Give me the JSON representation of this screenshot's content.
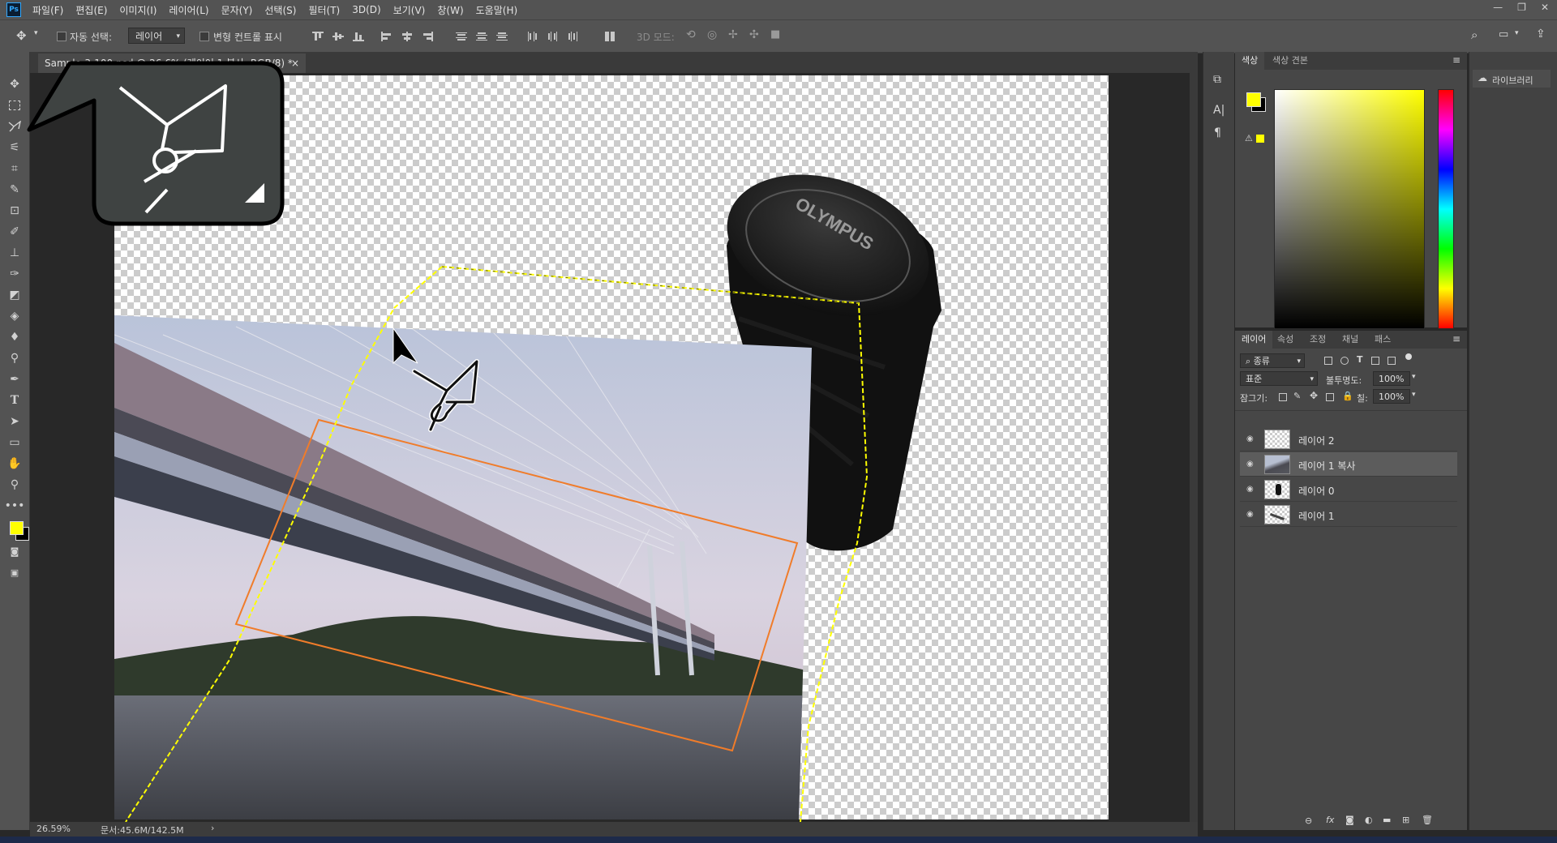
{
  "app": {
    "logo": "Ps"
  },
  "menu": [
    "파일(F)",
    "편집(E)",
    "이미지(I)",
    "레이어(L)",
    "문자(Y)",
    "선택(S)",
    "필터(T)",
    "3D(D)",
    "보기(V)",
    "창(W)",
    "도움말(H)"
  ],
  "window_controls": {
    "minimize": "—",
    "restore": "❐",
    "close": "✕"
  },
  "options": {
    "auto_select_label": "자동 선택:",
    "auto_select_value": "레이어",
    "transform_controls_label": "변형 컨트롤 표시",
    "mode_3d_label": "3D 모드:"
  },
  "document": {
    "tab_title": "Sample-3-100.psd @ 26.6% (레이어 1 복사, RGB/8) *",
    "tab_close": "×"
  },
  "canvas": {
    "lens_cap_text": "OLYMPUS"
  },
  "status": {
    "zoom": "26.59%",
    "doc_size": "문서:45.6M/142.5M",
    "arrow": "›"
  },
  "color_panel": {
    "tabs": [
      "색상",
      "색상 견본"
    ],
    "foreground": "#ffff00",
    "background": "#000000"
  },
  "layers_panel": {
    "tabs": [
      "레이어",
      "속성",
      "조정",
      "채널",
      "패스"
    ],
    "filter_label": "종류",
    "blend_mode": "표준",
    "opacity_label": "불투명도:",
    "opacity_value": "100%",
    "lock_label": "잠그기:",
    "fill_label": "칠:",
    "fill_value": "100%",
    "layers": [
      {
        "name": "레이어 2",
        "selected": false
      },
      {
        "name": "레이어 1 복사",
        "selected": true
      },
      {
        "name": "레이어 0",
        "selected": false
      },
      {
        "name": "레이어 1",
        "selected": false
      }
    ]
  },
  "library": {
    "label": "라이브러리"
  },
  "tool_callout": {
    "tool": "polygonal-lasso"
  }
}
